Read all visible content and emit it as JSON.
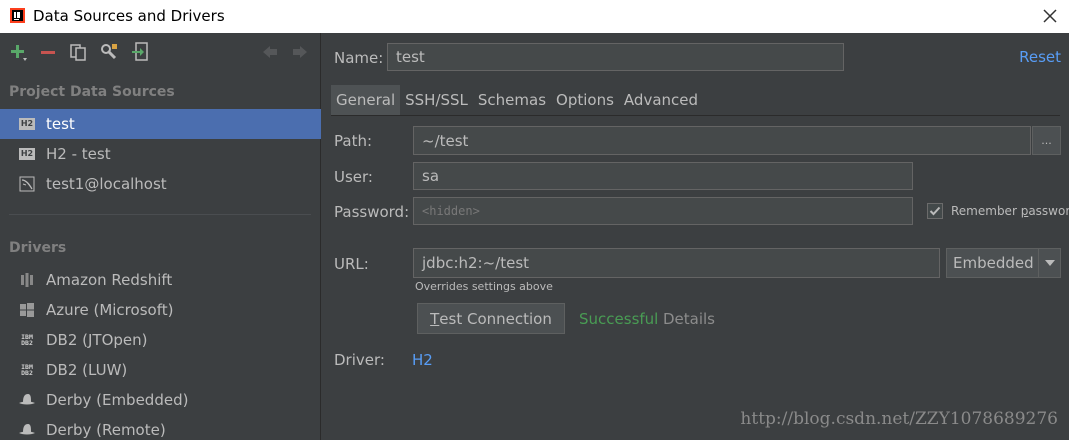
{
  "window": {
    "title": "Data Sources and Drivers",
    "app_icon": "intellij-app-icon",
    "close_icon": "close-icon"
  },
  "toolbar": {
    "buttons": [
      {
        "icon": "add-icon",
        "color": "#59a869"
      },
      {
        "icon": "remove-icon",
        "color": "#c75450"
      },
      {
        "icon": "copy-icon"
      },
      {
        "icon": "wrench-settings-icon"
      },
      {
        "icon": "import-icon",
        "color": "#59a869"
      },
      {
        "icon": "back-arrow-icon"
      },
      {
        "icon": "forward-arrow-icon"
      }
    ]
  },
  "left": {
    "project_header": "Project Data Sources",
    "data_sources": [
      {
        "label": "test",
        "icon": "h2-icon",
        "selected": true
      },
      {
        "label": "H2 - test",
        "icon": "h2-icon",
        "selected": false
      },
      {
        "label": "test1@localhost",
        "icon": "mysql-icon",
        "selected": false
      }
    ],
    "drivers_header": "Drivers",
    "drivers": [
      {
        "label": "Amazon Redshift",
        "icon": "redshift-icon"
      },
      {
        "label": "Azure (Microsoft)",
        "icon": "windows-icon"
      },
      {
        "label": "DB2 (JTOpen)",
        "icon": "ibm-db2-icon"
      },
      {
        "label": "DB2 (LUW)",
        "icon": "ibm-db2-icon"
      },
      {
        "label": "Derby (Embedded)",
        "icon": "derby-hat-icon"
      },
      {
        "label": "Derby (Remote)",
        "icon": "derby-hat-icon"
      }
    ],
    "badges": {
      "h2": "H2",
      "ibm_top": "IBM",
      "ibm_bottom": "DB2"
    }
  },
  "form": {
    "name_label": "Name:",
    "name_value": "test",
    "reset_label": "Reset",
    "tabs": [
      {
        "label": "General",
        "active": true
      },
      {
        "label": "SSH/SSL",
        "active": false
      },
      {
        "label": "Schemas",
        "active": false
      },
      {
        "label": "Options",
        "active": false
      },
      {
        "label": "Advanced",
        "active": false
      }
    ],
    "path_label": "Path:",
    "path_value": "~/test",
    "browse_label": "...",
    "user_label": "User:",
    "user_value": "sa",
    "password_label": "Password:",
    "password_placeholder": "<hidden>",
    "remember_label_pre": "Remember ",
    "remember_label_mnemonic": "p",
    "remember_label_post": "assword",
    "remember_checked": true,
    "url_label": "URL:",
    "url_value": "jdbc:h2:~/test",
    "url_mode": "Embedded",
    "url_hint": "Overrides settings above",
    "test_btn_mnemonic": "T",
    "test_btn_rest": "est Connection",
    "status_text": "Successful",
    "details_label": "Details",
    "driver_label": "Driver:",
    "driver_value": "H2"
  },
  "watermark": "http://blog.csdn.net/ZZY1078689276",
  "colors": {
    "background": "#3c3f41",
    "selection": "#4b6eaf",
    "link": "#589df6",
    "success": "#499c54",
    "input_bg": "#45494a"
  }
}
